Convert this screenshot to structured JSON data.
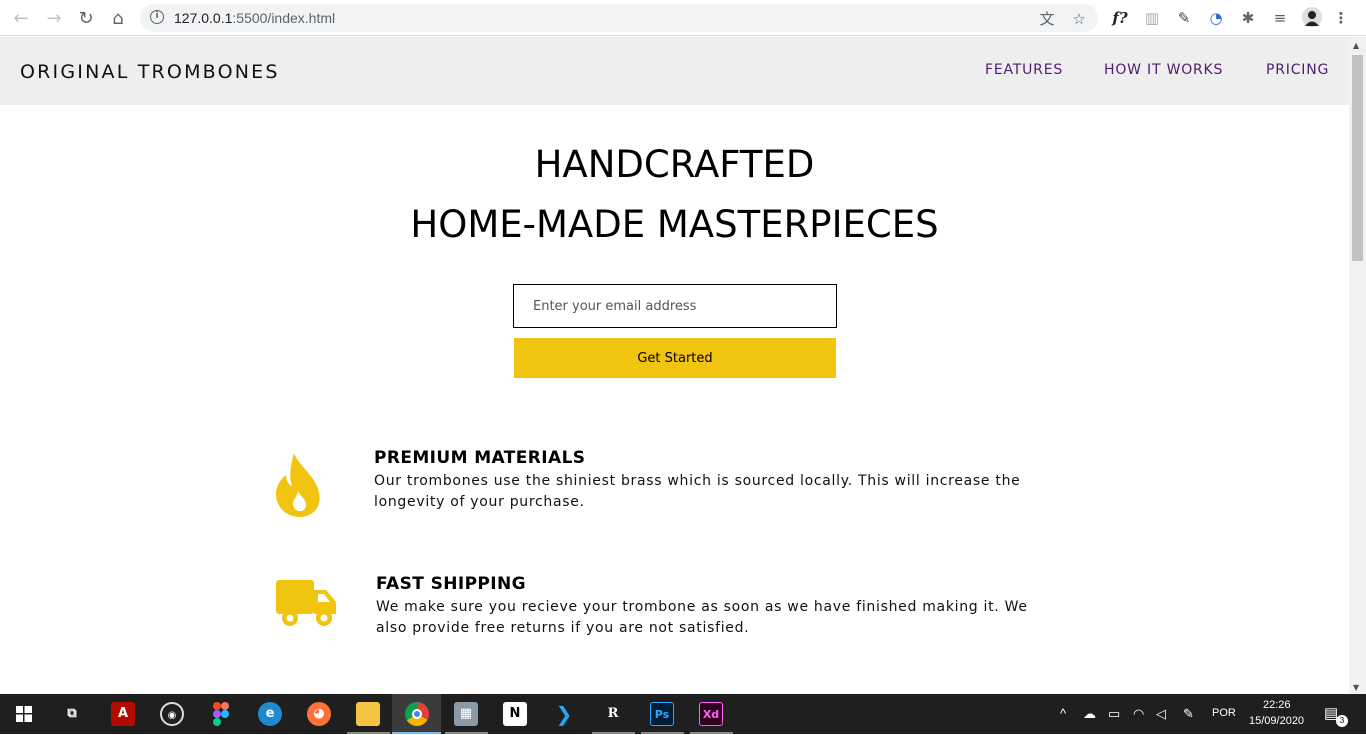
{
  "browser": {
    "url_host": "127.0.0.1",
    "url_path": ":5500/index.html"
  },
  "site": {
    "logo": "ORIGINAL TROMBONES",
    "nav": [
      "FEATURES",
      "HOW IT WORKS",
      "PRICING"
    ]
  },
  "hero": {
    "title_line1": "HANDCRAFTED",
    "title_line2": "HOME-MADE MASTERPIECES",
    "email_placeholder": "Enter your email address",
    "cta_label": "Get Started"
  },
  "features": [
    {
      "title": "PREMIUM MATERIALS",
      "line1": "Our trombones use the shiniest brass which is sourced locally. This will increase the",
      "line2": "longevity of your purchase.",
      "icon": "fire-icon"
    },
    {
      "title": "FAST SHIPPING",
      "line1": "We make sure you recieve your trombone as soon as we have finished making it. We",
      "line2": "also provide free returns if you are not satisfied.",
      "icon": "truck-icon"
    }
  ],
  "taskbar": {
    "language": "POR",
    "time": "22:26",
    "date": "15/09/2020",
    "notification_count": "3"
  },
  "colors": {
    "accent": "#f1c40f",
    "nav_link": "#4b1f6f",
    "header_bg": "#eeeeee"
  }
}
